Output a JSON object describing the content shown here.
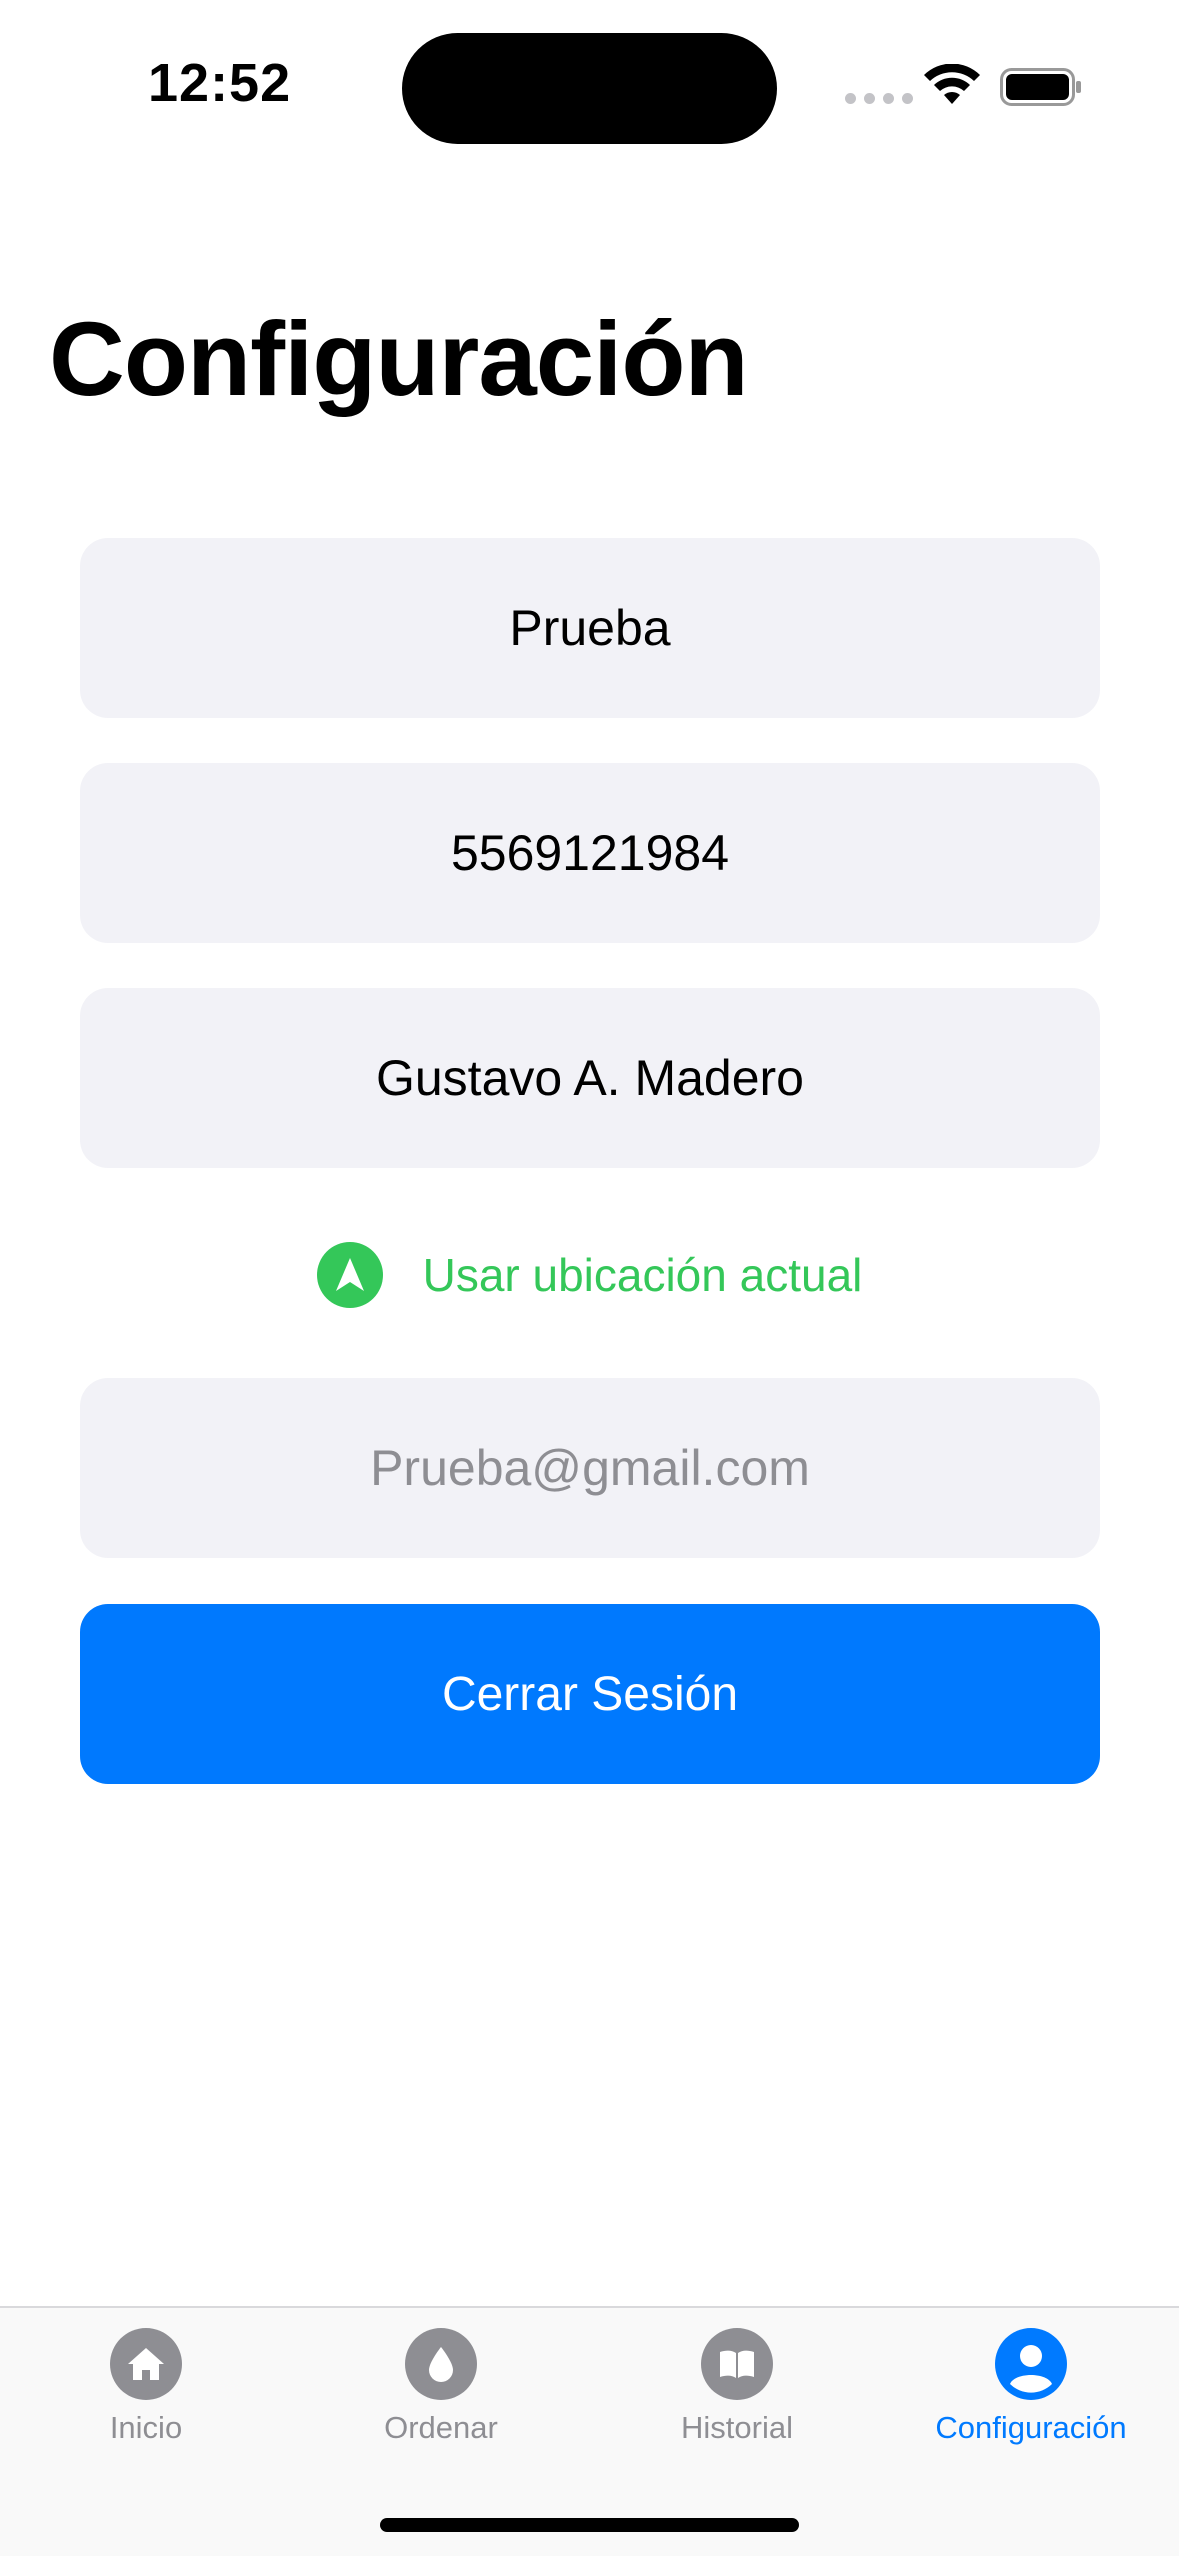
{
  "status_bar": {
    "time": "12:52"
  },
  "title": "Configuración",
  "form": {
    "name_value": "Prueba",
    "phone_value": "5569121984",
    "area_value": "Gustavo A. Madero",
    "location_label": "Usar ubicación actual",
    "email_placeholder": "Prueba@gmail.com",
    "logout_label": "Cerrar Sesión"
  },
  "colors": {
    "accent": "#007aff",
    "button": "#0079fe",
    "location_green": "#34c759",
    "field_bg": "#f2f2f7",
    "inactive_tab": "#8e8e93"
  },
  "tabbar": {
    "items": [
      {
        "label": "Inicio",
        "icon": "house-icon",
        "active": false
      },
      {
        "label": "Ordenar",
        "icon": "drop-icon",
        "active": false
      },
      {
        "label": "Historial",
        "icon": "book-icon",
        "active": false
      },
      {
        "label": "Configuración",
        "icon": "person-icon",
        "active": true
      }
    ]
  }
}
